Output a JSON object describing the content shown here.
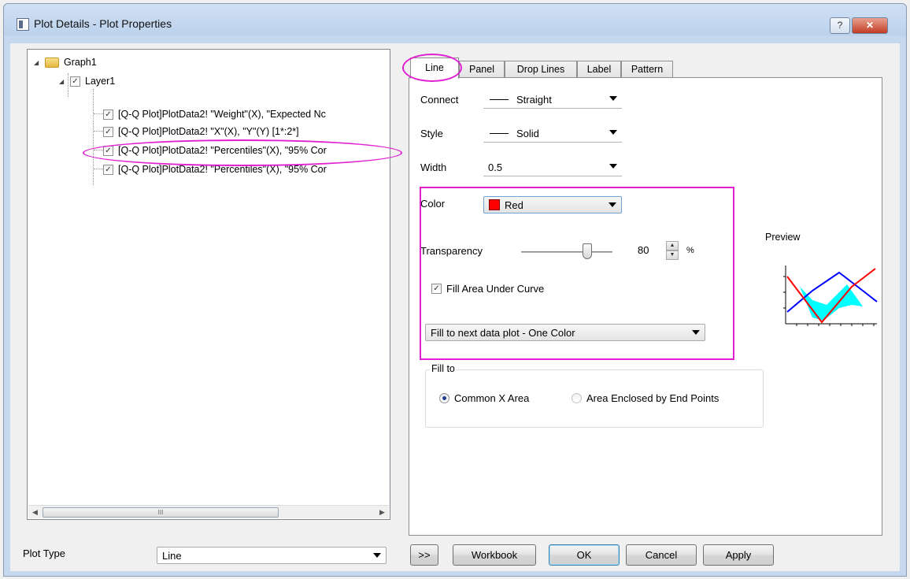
{
  "window": {
    "title": "Plot Details - Plot Properties",
    "help_label": "?",
    "close_label": "✕"
  },
  "tree": {
    "root": "Graph1",
    "layer": "Layer1",
    "items": [
      "[Q-Q Plot]PlotData2! \"Weight\"(X), \"Expected Nc",
      "[Q-Q Plot]PlotData2! \"X\"(X), \"Y\"(Y) [1*:2*]",
      "[Q-Q Plot]PlotData2! \"Percentiles\"(X), \"95% Cor",
      "[Q-Q Plot]PlotData2! \"Percentiles\"(X), \"95% Cor"
    ],
    "check_mark": "✓",
    "scroll_grip": "III"
  },
  "tabs": [
    "Line",
    "Panel",
    "Drop Lines",
    "Label",
    "Pattern"
  ],
  "line_tab": {
    "connect_label": "Connect",
    "connect_value": "Straight",
    "style_label": "Style",
    "style_value": "Solid",
    "width_label": "Width",
    "width_value": "0.5",
    "color_label": "Color",
    "color_value": "Red",
    "color_hex": "#ff0000",
    "transparency_label": "Transparency",
    "transparency_value": "80",
    "transparency_unit": "%",
    "fill_area_label": "Fill Area Under Curve",
    "fill_area_checked": true,
    "fill_mode_value": "Fill to next data plot - One Color",
    "fill_to_label": "Fill to",
    "fill_to_options": [
      "Common X Area",
      "Area Enclosed by End Points"
    ],
    "fill_to_selected": "Common X Area",
    "preview_label": "Preview"
  },
  "bottom": {
    "plot_type_label": "Plot Type",
    "plot_type_value": "Line",
    "expand_label": ">>",
    "workbook_label": "Workbook",
    "ok_label": "OK",
    "cancel_label": "Cancel",
    "apply_label": "Apply"
  },
  "colors": {
    "highlight": "#e020d0",
    "preview_line_red": "#ff0000",
    "preview_line_blue": "#0000ff",
    "preview_fill": "#00ffff"
  }
}
